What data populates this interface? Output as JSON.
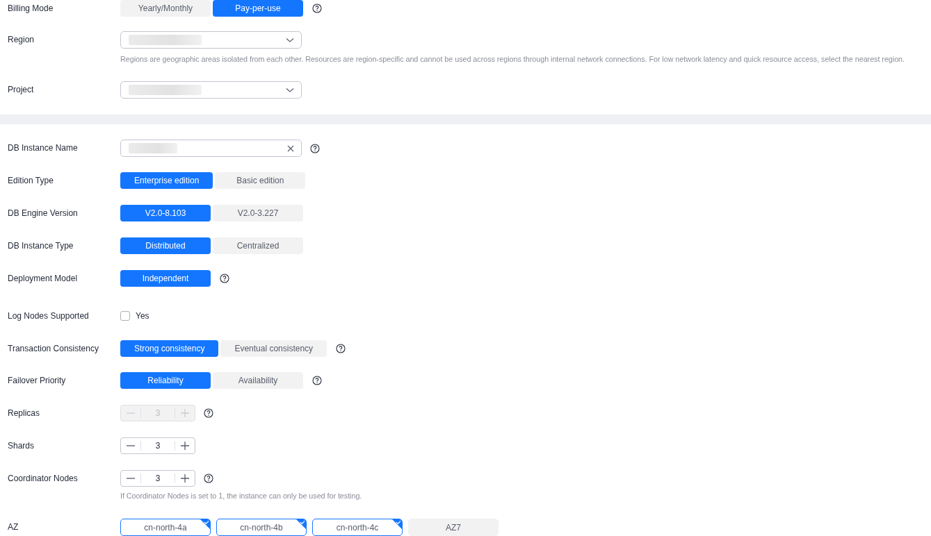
{
  "sections": [
    {
      "rows": [
        {
          "kind": "segmented",
          "label": "Billing Mode",
          "help": true,
          "options": [
            {
              "label": "Yearly/Monthly",
              "selected": false
            },
            {
              "label": "Pay-per-use",
              "selected": true
            }
          ]
        },
        {
          "kind": "select",
          "label": "Region",
          "hint": "Regions are geographic areas isolated from each other. Resources are region-specific and cannot be used across regions through internal network connections. For low network latency and quick resource access, select the nearest region."
        },
        {
          "kind": "select",
          "label": "Project"
        }
      ]
    },
    {
      "rows": [
        {
          "kind": "text_field",
          "label": "DB Instance Name",
          "help": true
        },
        {
          "kind": "segmented",
          "label": "Edition Type",
          "options": [
            {
              "label": "Enterprise edition",
              "selected": true
            },
            {
              "label": "Basic edition",
              "selected": false
            }
          ]
        },
        {
          "kind": "segmented",
          "label": "DB Engine Version",
          "options": [
            {
              "label": "V2.0-8.103",
              "selected": true
            },
            {
              "label": "V2.0-3.227",
              "selected": false
            }
          ]
        },
        {
          "kind": "segmented",
          "label": "DB Instance Type",
          "options": [
            {
              "label": "Distributed",
              "selected": true
            },
            {
              "label": "Centralized",
              "selected": false
            }
          ]
        },
        {
          "kind": "segmented",
          "label": "Deployment Model",
          "help": true,
          "options": [
            {
              "label": "Independent",
              "selected": true
            }
          ]
        },
        {
          "kind": "checkbox",
          "label": "Log Nodes Supported",
          "option": "Yes",
          "checked": false
        },
        {
          "kind": "segmented",
          "label": "Transaction Consistency",
          "help": true,
          "options": [
            {
              "label": "Strong consistency",
              "selected": true
            },
            {
              "label": "Eventual consistency",
              "selected": false
            }
          ]
        },
        {
          "kind": "segmented",
          "label": "Failover Priority",
          "help": true,
          "options": [
            {
              "label": "Reliability",
              "selected": true
            },
            {
              "label": "Availability",
              "selected": false
            }
          ]
        },
        {
          "kind": "stepper",
          "label": "Replicas",
          "value": "3",
          "disabled": true,
          "help": true
        },
        {
          "kind": "stepper",
          "label": "Shards",
          "value": "3",
          "disabled": false
        },
        {
          "kind": "stepper",
          "label": "Coordinator Nodes",
          "value": "3",
          "disabled": false,
          "help": true,
          "hint": "If Coordinator Nodes is set to 1, the instance can only be used for testing."
        },
        {
          "kind": "chips",
          "label": "AZ",
          "options": [
            {
              "label": "cn-north-4a",
              "selected": true
            },
            {
              "label": "cn-north-4b",
              "selected": true
            },
            {
              "label": "cn-north-4c",
              "selected": true
            },
            {
              "label": "AZ7",
              "selected": false
            }
          ]
        }
      ]
    }
  ]
}
